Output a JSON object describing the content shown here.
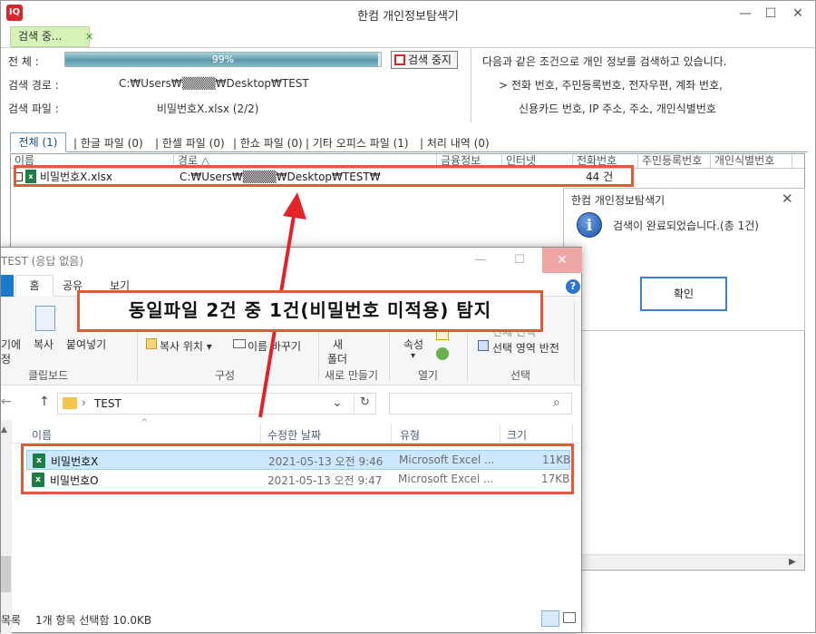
{
  "app": {
    "title": "한컴 개인정보탐색기",
    "logo_glyph": "IQ",
    "window_buttons": {
      "minimize": "—",
      "maximize": "☐",
      "close": "✕"
    }
  },
  "search_tab": {
    "label": "검색 중...",
    "close": "✕"
  },
  "progress_section": {
    "total_label": "전      체 :",
    "progress_percent": 99,
    "progress_text": "99%",
    "stop_button": "검색 중지",
    "path_label": "검색 경로 :",
    "path_value": "C:₩Users₩▒▒▒▒₩Desktop₩TEST",
    "file_label": "검색 파일 :",
    "file_value": "비밀번호X.xlsx (2/2)"
  },
  "info": {
    "line1": "다음과 같은 조건으로 개인 정보를 검색하고 있습니다.",
    "line2": "> 전화 번호, 주민등록번호, 전자우편, 계좌 번호,",
    "line3": "신용카드 번호, IP 주소, 주소, 개인식별번호"
  },
  "result_tabs": [
    {
      "label": "전체 (1)"
    },
    {
      "label": "| 한글 파일 (0)"
    },
    {
      "label": "| 한셀 파일 (0)"
    },
    {
      "label": "| 한쇼 파일 (0)"
    },
    {
      "label": "| 기타 오피스 파일 (1)"
    },
    {
      "label": "| 처리 내역 (0)"
    }
  ],
  "grid": {
    "headers": [
      "이름",
      "경로 △",
      "금융정보",
      "인터넷",
      "전화번호",
      "주민등록번호",
      "개인식별번호"
    ],
    "row": {
      "name": "비밀번호X.xlsx",
      "path": "C:₩Users₩▒▒▒▒₩Desktop₩TEST₩",
      "phone_count": "44 건"
    }
  },
  "dialog": {
    "title": "한컴 개인정보탐색기",
    "close": "✕",
    "icon_glyph": "i",
    "message": "검색이 완료되었습니다.(총 1건)",
    "ok_button": "확인"
  },
  "explorer": {
    "title": "TEST (응답 없음)",
    "window_buttons": {
      "minimize": "—",
      "maximize": "☐",
      "close": "✕"
    },
    "tabs": [
      "홈",
      "공유",
      "보기"
    ],
    "help": "?",
    "ribbon": {
      "pin_label": "기에",
      "pin_label2": "정",
      "copy": "복사",
      "paste": "붙여넣기",
      "move_to": "복사 위치 ▾",
      "rename": "이름 바꾸기",
      "new_folder_1": "새",
      "new_folder_2": "폴더",
      "properties": "속성",
      "properties_arrow": "▾",
      "select_all_partial": "전체 선택",
      "invert_selection": "선택 영역 반전",
      "groups": [
        "클립보드",
        "구성",
        "새로 만들기",
        "열기",
        "선택"
      ]
    },
    "nav": {
      "back": "←",
      "up": "↑",
      "sep": "›",
      "path": "TEST",
      "dropdown": "⌄",
      "refresh": "↻",
      "search_icon": "⌕"
    },
    "columns": [
      "이름",
      "수정한 날짜",
      "유형",
      "크기"
    ],
    "sort_arrow": "^",
    "files": [
      {
        "name": "비밀번호X",
        "date": "2021-05-13 오전 9:46",
        "type": "Microsoft Excel ...",
        "size": "11KB",
        "selected": true
      },
      {
        "name": "비밀번호O",
        "date": "2021-05-13 오전 9:47",
        "type": "Microsoft Excel ...",
        "size": "17KB",
        "selected": false
      }
    ],
    "status": {
      "left": "목록",
      "selection": "1개 항목 선택함 10.0KB"
    }
  },
  "annotation": {
    "label": "동일파일 2건 중 1건(비밀번호 미적용) 탐지",
    "color": "#e05a38",
    "arrow_color": "#e2232a"
  }
}
